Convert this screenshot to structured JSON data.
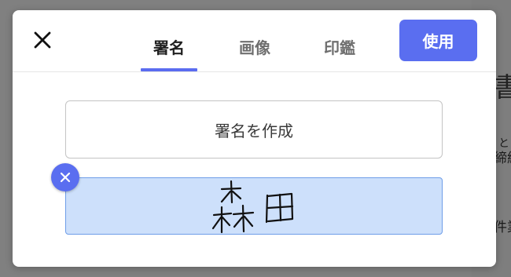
{
  "background_fragments": [
    "書",
    "と",
    "締結",
    "件業"
  ],
  "dialog": {
    "close_icon": "close-icon",
    "tabs": [
      {
        "label": "署名",
        "active": true
      },
      {
        "label": "画像",
        "active": false
      },
      {
        "label": "印鑑",
        "active": false
      }
    ],
    "use_button_label": "使用",
    "create_signature_label": "署名を作成",
    "saved_signature": {
      "handwritten_text": "森田",
      "remove_icon": "remove-x-icon"
    }
  },
  "colors": {
    "accent": "#5a6ef0",
    "signature_card_bg": "#cde0fb",
    "signature_card_border": "#6e9de8",
    "overlay": "#808080"
  }
}
